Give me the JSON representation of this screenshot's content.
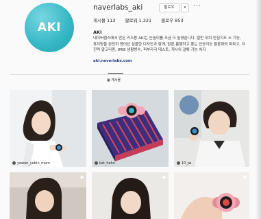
{
  "profile": {
    "avatar_text": "AKI",
    "username": "naverlabs_aki",
    "follow_label": "팔로우",
    "dropdown_glyph": "▾",
    "more_glyph": "···",
    "stats": {
      "posts": "게시물 113",
      "followers": "팔로워 1,321",
      "following": "팔로우 853"
    },
    "full_name": "AKI",
    "bio": "네이버랩스에서 만든 키즈용 AKI는 눈높이를 조금 더 높였습니다. 말만 위치 안심지도 스 기능, 휴지방을 완전히 챙어선 심플한 디자인과 함께, 밤론 롱행하고 좋는 인공지능 플론화와 파파고, 자진력 알고리즘, IP68 생활방수, 피부자극 테스트, 개시위 걸해 기능 차지",
    "link": "aki.naverlabs.com"
  },
  "tabs": [
    {
      "label": "▦ 게시물"
    }
  ],
  "posts": [
    {
      "caption": "yewon_yebin_mom",
      "video": false
    },
    {
      "caption": "kat_hohn",
      "video": false
    },
    {
      "caption": "10_jw",
      "video": false
    },
    {
      "caption": "",
      "video": true
    },
    {
      "caption": "",
      "video": true
    },
    {
      "caption": "",
      "video": true
    }
  ],
  "icons": {
    "video_icon": "▶"
  },
  "colors": {
    "avatar_accent": "#39b9c7",
    "watch_pink": "#f4a6b4",
    "watch_face": "#1e1e1e",
    "link_color": "#25387a"
  }
}
